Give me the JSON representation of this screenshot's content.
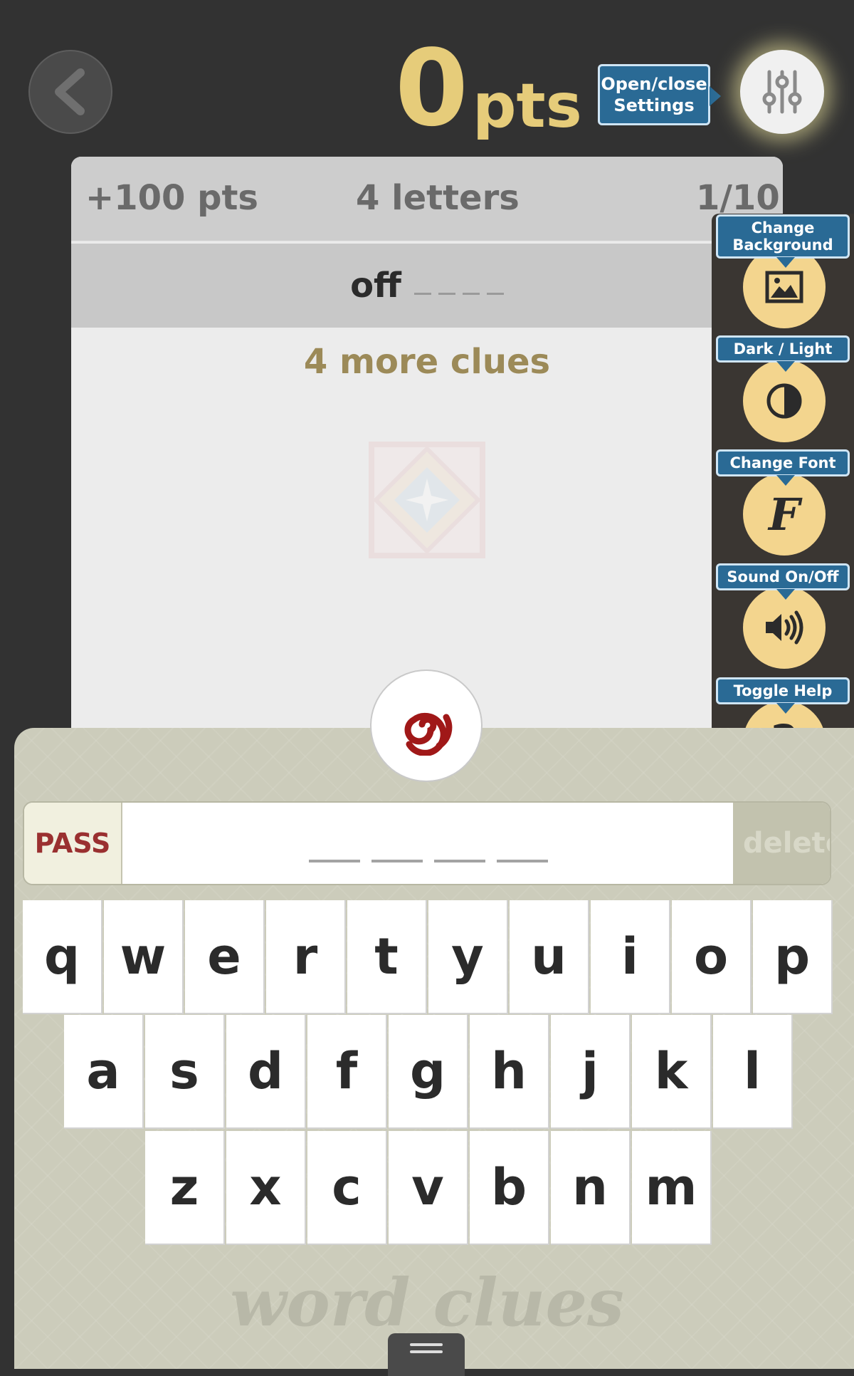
{
  "header": {
    "score_value": "0",
    "score_unit": "pts",
    "settings_tooltip_line1": "Open/close",
    "settings_tooltip_line2": "Settings"
  },
  "card": {
    "points": "+100 pts",
    "letters": "4 letters",
    "progress": "1/10",
    "clue_word": "off",
    "more_clues": "4 more clues"
  },
  "settings_panel": {
    "items": [
      {
        "tooltip_line1": "Change",
        "tooltip_line2": "Background",
        "icon": "image-icon"
      },
      {
        "tooltip_line1": "Dark / Light",
        "tooltip_line2": "",
        "icon": "contrast-icon"
      },
      {
        "tooltip_line1": "Change Font",
        "tooltip_line2": "",
        "icon": "font-icon"
      },
      {
        "tooltip_line1": "Sound On/Off",
        "tooltip_line2": "",
        "icon": "speaker-icon"
      },
      {
        "tooltip_line1": "Toggle Help",
        "tooltip_line2": "",
        "icon": "help-icon"
      }
    ],
    "font_glyph": "F",
    "help_glyph": "?"
  },
  "answer": {
    "pass_label": "PASS",
    "delete_label": "delete",
    "blank_count": 4
  },
  "keyboard": {
    "row1": [
      "q",
      "w",
      "e",
      "r",
      "t",
      "y",
      "u",
      "i",
      "o",
      "p"
    ],
    "row2": [
      "a",
      "s",
      "d",
      "f",
      "g",
      "h",
      "j",
      "k",
      "l"
    ],
    "row3": [
      "z",
      "x",
      "c",
      "v",
      "b",
      "n",
      "m"
    ]
  },
  "brand": "word clues",
  "colors": {
    "score": "#e6cc7a",
    "tooltip": "#2a6a95",
    "side_button": "#f3d58e",
    "pass": "#9a3030",
    "more_clues": "#9c8a58",
    "logo": "#a01818"
  }
}
